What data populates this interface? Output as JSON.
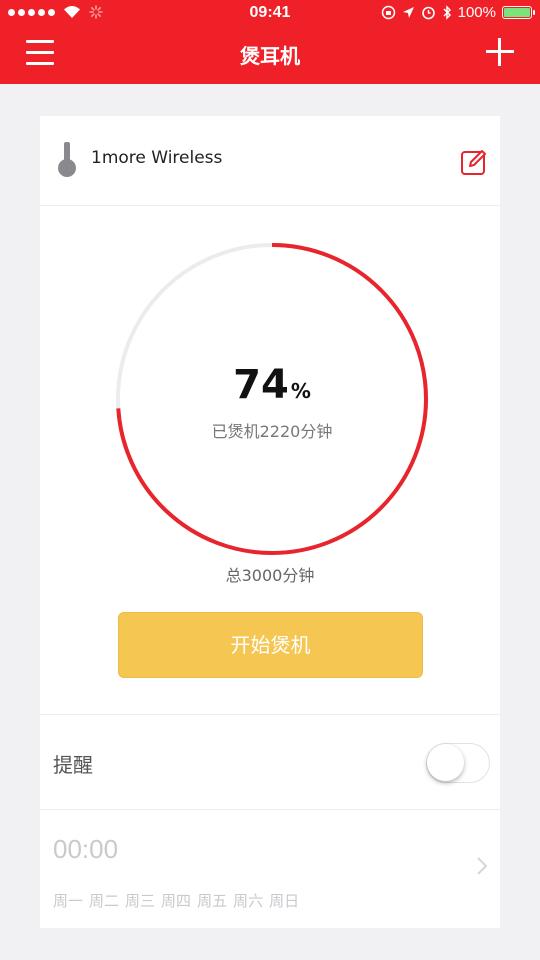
{
  "status_bar": {
    "time": "09:41",
    "battery": "100%",
    "battery_color": "#7ee27a"
  },
  "nav": {
    "title": "煲耳机",
    "menu_icon": "hamburger-icon",
    "add_icon": "plus-icon",
    "bg_color": "#f02028"
  },
  "device": {
    "name": "1more Wireless",
    "icon": "earbud-icon",
    "edit_icon": "edit-icon"
  },
  "progress": {
    "percent": "74",
    "percent_unit": "%",
    "fraction": 0.74,
    "burned_text": "已煲机2220分钟",
    "total_text": "总3000分钟",
    "ring_color": "#e8242c",
    "track_color": "#ececee"
  },
  "start_button": {
    "label": "开始煲机",
    "color": "#f6c652"
  },
  "reminder": {
    "label": "提醒",
    "enabled": false
  },
  "alarm": {
    "time": "00:00",
    "days": [
      "周一",
      "周二",
      "周三",
      "周四",
      "周五",
      "周六",
      "周日"
    ]
  }
}
